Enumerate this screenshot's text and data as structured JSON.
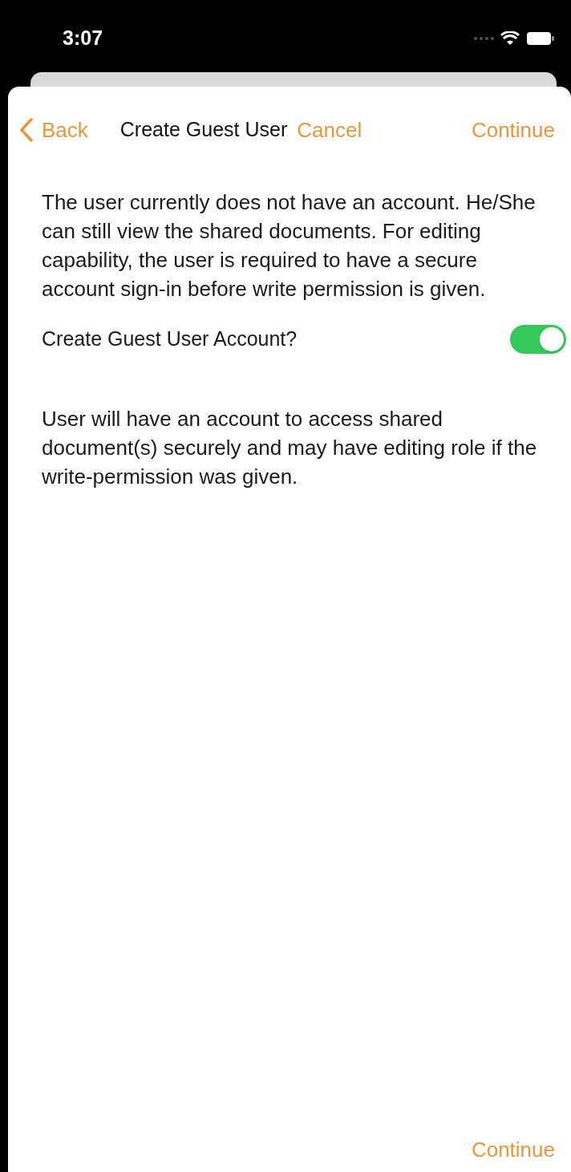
{
  "status_bar": {
    "time": "3:07"
  },
  "nav": {
    "back": "Back",
    "title": "Create Guest User",
    "cancel": "Cancel",
    "continue": "Continue"
  },
  "intro": "The user currently does not have an account. He/She can still view the shared documents. For editing capability, the user is required to have a secure account sign-in before write permission is given.",
  "guest_toggle": {
    "label": "Create Guest User Account?",
    "on": true
  },
  "note": "User will have an account to access shared document(s) securely and may have editing role if the write-permission was given.",
  "footer": {
    "continue": "Continue"
  }
}
